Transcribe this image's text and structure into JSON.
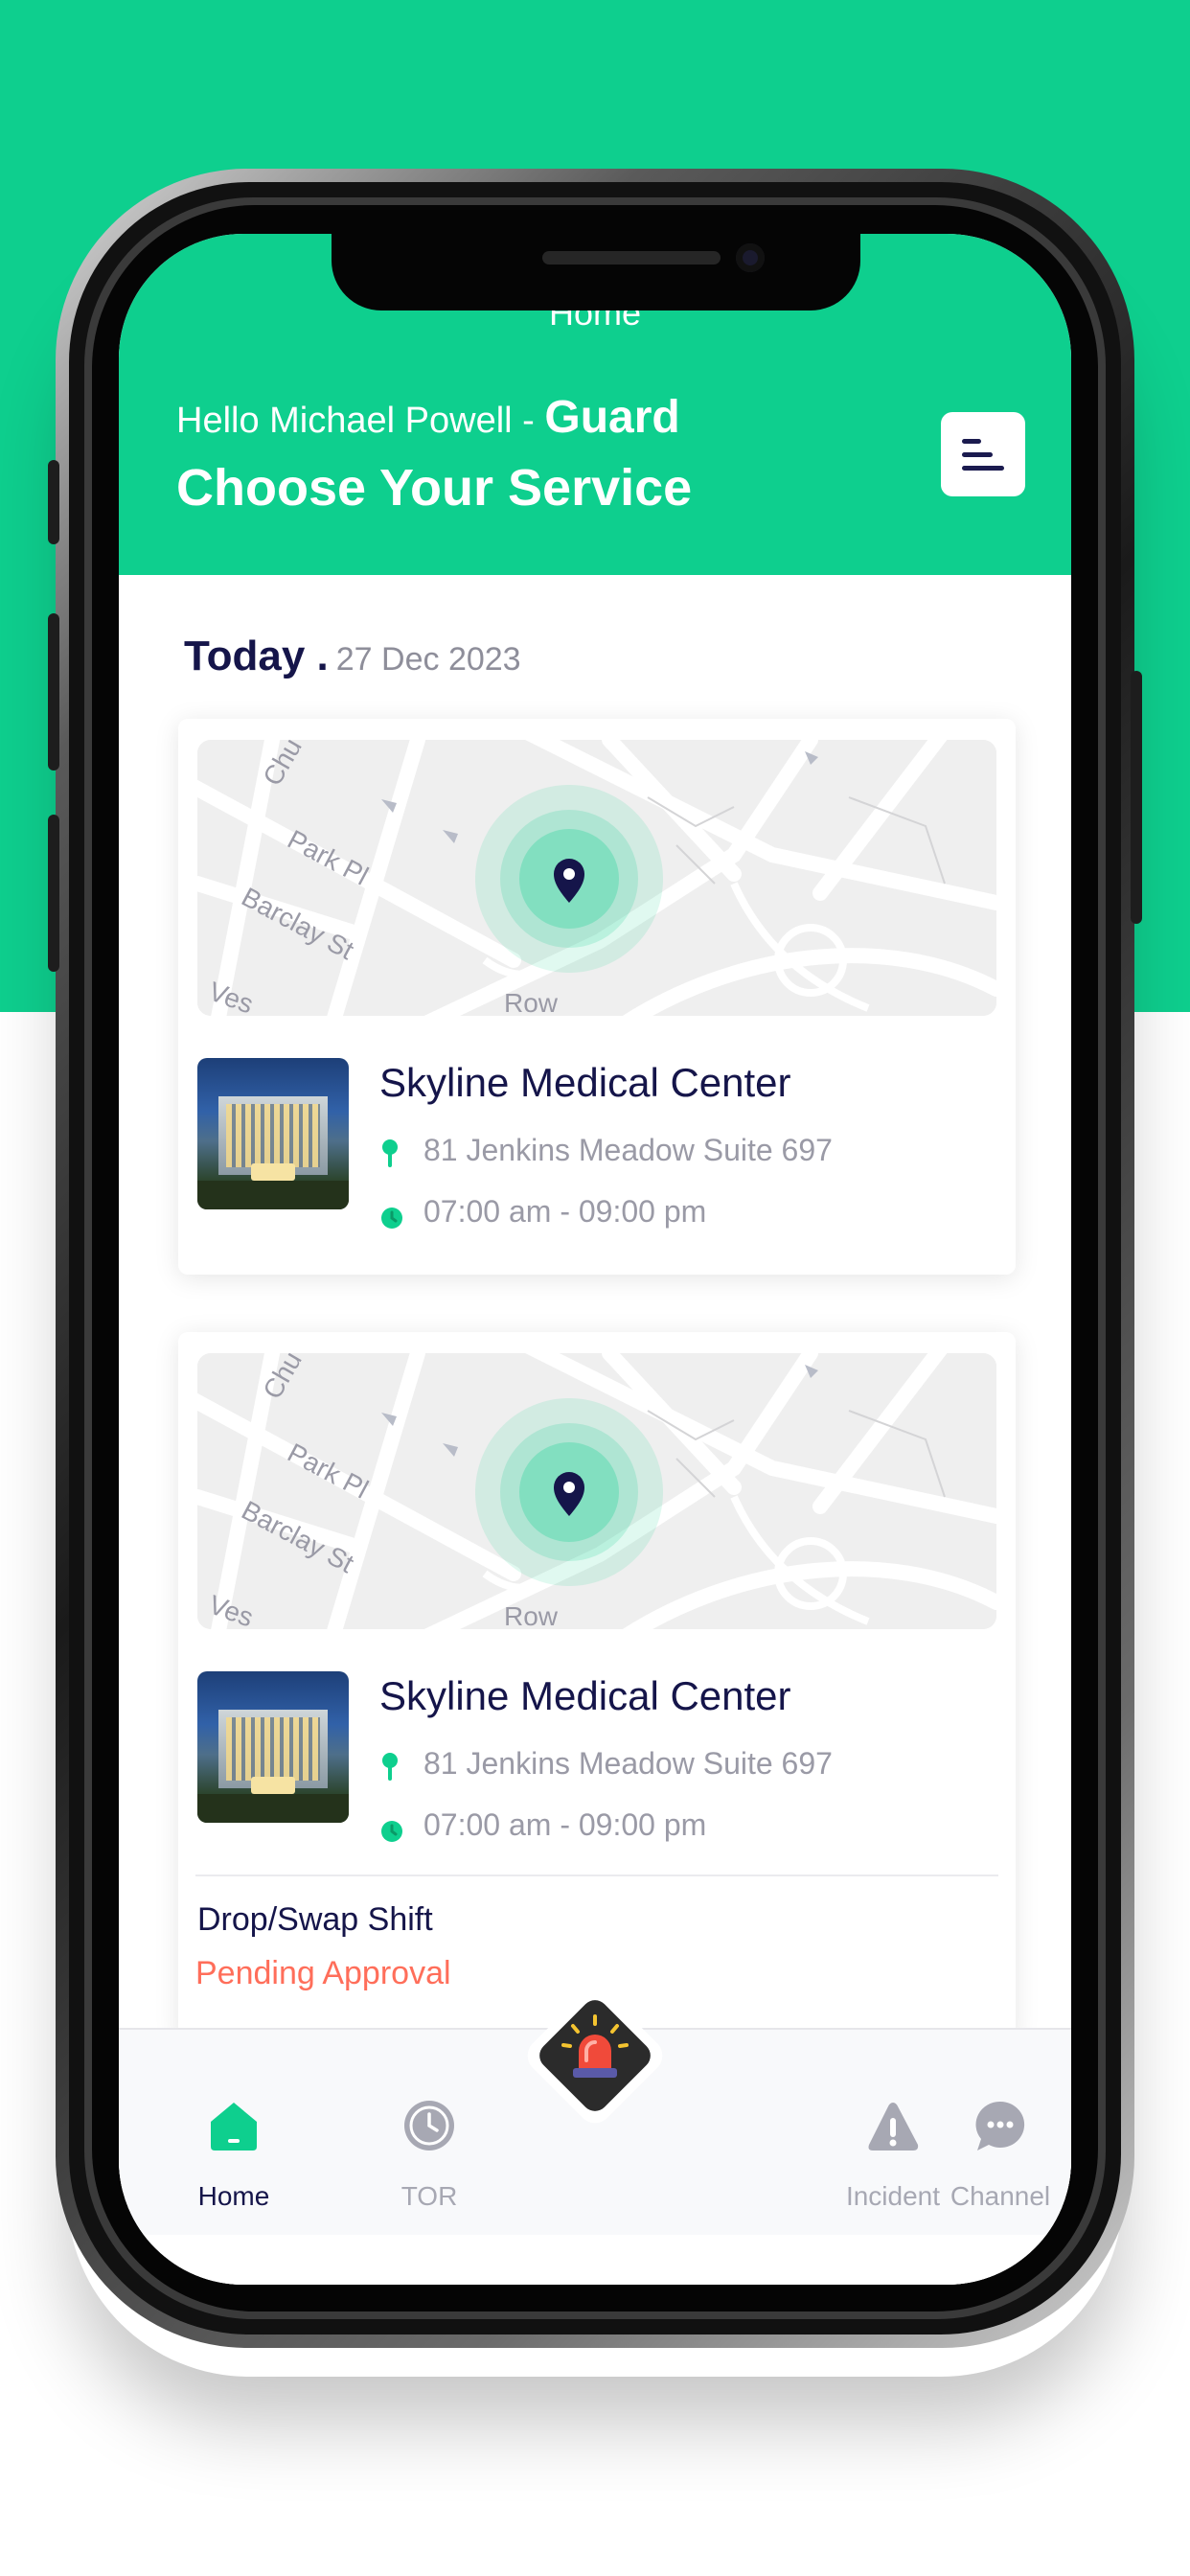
{
  "colors": {
    "brand": "#0ecf8e",
    "navy": "#15154a",
    "muted": "#9a9aa6",
    "pending": "#ff6e5a"
  },
  "header": {
    "nav_title": "Home",
    "greeting": "Hello Michael Powell - ",
    "role": "Guard",
    "subtitle": "Choose Your Service",
    "menu_icon": "menu-icon"
  },
  "today": {
    "label": "Today .",
    "date": "27 Dec 2023"
  },
  "map_labels": [
    "Park Pl",
    "Barclay St",
    "Chu",
    "Ves",
    "Row"
  ],
  "shifts": [
    {
      "name": "Skyline Medical Center",
      "address": "81 Jenkins Meadow Suite 697",
      "hours": "07:00 am - 09:00 pm"
    },
    {
      "name": "Skyline Medical Center",
      "address": "81 Jenkins Meadow Suite 697",
      "hours": "07:00 am - 09:00 pm",
      "request_type": "Drop/Swap Shift",
      "status": "Pending Approval"
    }
  ],
  "tabs": [
    {
      "label": "Home",
      "icon": "home-icon",
      "active": true
    },
    {
      "label": "TOR",
      "icon": "clock-icon",
      "active": false
    },
    {
      "label": "Incident",
      "icon": "warning-icon",
      "active": false
    },
    {
      "label": "Channel",
      "icon": "chat-icon",
      "active": false
    }
  ],
  "sos_icon": "siren-icon"
}
